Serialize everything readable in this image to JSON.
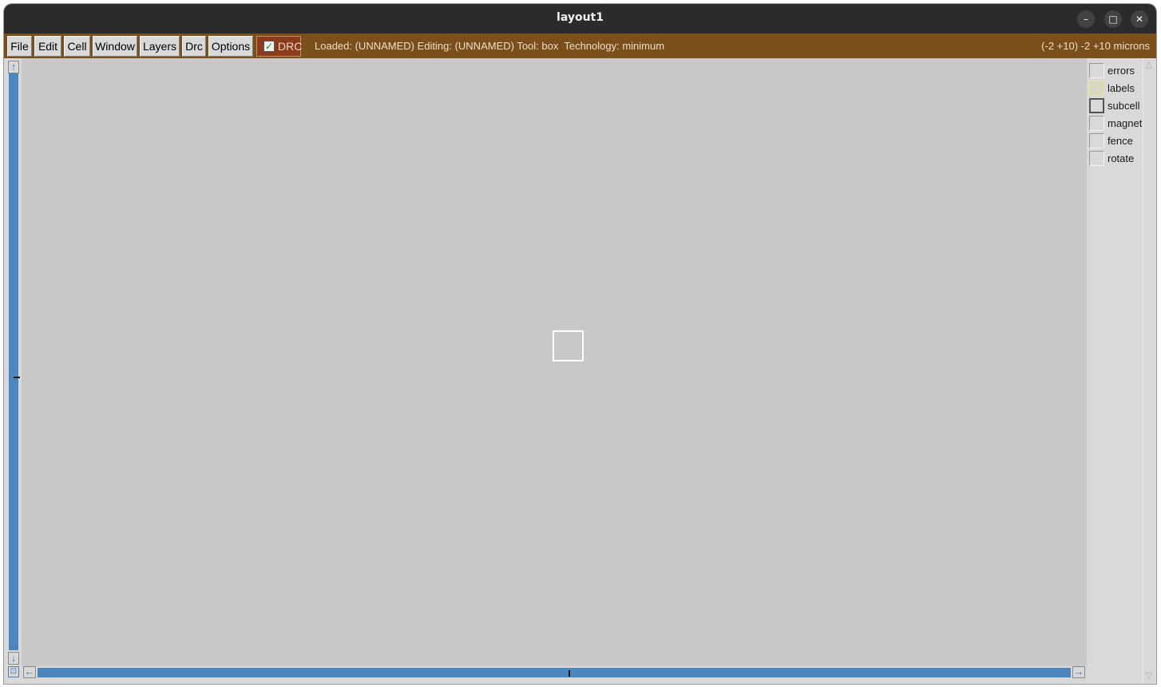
{
  "window": {
    "title": "layout1",
    "controls": {
      "minimize": "–",
      "maximize": "□",
      "close": "✕"
    }
  },
  "menubar": {
    "items": [
      "File",
      "Edit",
      "Cell",
      "Window",
      "Layers",
      "Drc",
      "Options"
    ],
    "drc_toggle": {
      "label": "DRC",
      "checked": true
    },
    "status": "Loaded: (UNNAMED) Editing: (UNNAMED) Tool: box  Technology: minimum",
    "coords": "(-2 +10) -2 +10 microns",
    "accent_color": "#7a4f1c"
  },
  "layers": {
    "items": [
      {
        "label": "errors"
      },
      {
        "label": "labels"
      },
      {
        "label": "subcell"
      },
      {
        "label": "magnet"
      },
      {
        "label": "fence"
      },
      {
        "label": "rotate"
      }
    ]
  },
  "scroll": {
    "up_icon": "↑",
    "down_icon": "↓",
    "left_icon": "←",
    "right_icon": "→",
    "corner_icon": "⊡",
    "track_color": "#4a86c0"
  },
  "canvas": {
    "background": "#c8c8c8"
  }
}
